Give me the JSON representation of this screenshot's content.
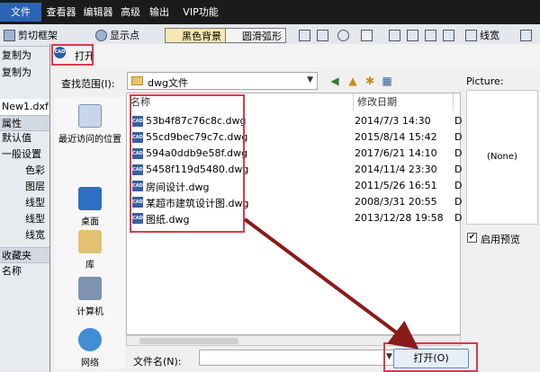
{
  "app": {
    "menu": [
      "文件",
      "查看器",
      "编辑器",
      "高级",
      "输出",
      "VIP功能"
    ],
    "toolbar": {
      "cut_frame": "剪切框架",
      "show_points": "显示点",
      "black_bg": "黑色背景",
      "smooth_arc": "圆滑弧形",
      "linewidth": "线宽",
      "copy1": "复制为",
      "copy2": "复制为"
    },
    "left_panel": {
      "tab": "New1.dxf",
      "attrs": "属性",
      "defaults": "默认值",
      "general": "一般设置",
      "color": "色彩",
      "layer": "图层",
      "linetype": "线型",
      "linetype2": "线型",
      "linewidth": "线宽",
      "favorites": "收藏夹",
      "name": "名称"
    }
  },
  "dialog": {
    "title": "打开",
    "lookin_label": "查找范围(I):",
    "lookin_value": "dwg文件",
    "places": [
      "最近访问的位置",
      "桌面",
      "库",
      "计算机",
      "网络"
    ],
    "columns": {
      "name": "名称",
      "date": "修改日期"
    },
    "files": [
      {
        "name": "53b4f87c76c8c.dwg",
        "date": "2014/7/3 14:30",
        "extra": "D"
      },
      {
        "name": "55cd9bec79c7c.dwg",
        "date": "2015/8/14 15:42",
        "extra": "D"
      },
      {
        "name": "594a0ddb9e58f.dwg",
        "date": "2017/6/21 14:10",
        "extra": "D"
      },
      {
        "name": "5458f119d5480.dwg",
        "date": "2014/11/4 23:30",
        "extra": "D"
      },
      {
        "name": "房间设计.dwg",
        "date": "2011/5/26 16:51",
        "extra": "D"
      },
      {
        "name": "某超市建筑设计图.dwg",
        "date": "2008/3/31 20:55",
        "extra": "D"
      },
      {
        "name": "图纸.dwg",
        "date": "2013/12/28 19:58",
        "extra": "D"
      }
    ],
    "file_icon_text": "CAD",
    "filename_label": "文件名(N):",
    "filename_value": "",
    "open_button": "打开(O)",
    "preview_label": "Picture:",
    "preview_none": "(None)",
    "preview_checkbox": "启用预览",
    "preview_checked": true
  },
  "colors": {
    "highlight_box": "#d93a4a",
    "menu_active": "#2b63b5",
    "arrow": "#8b1a1a"
  }
}
